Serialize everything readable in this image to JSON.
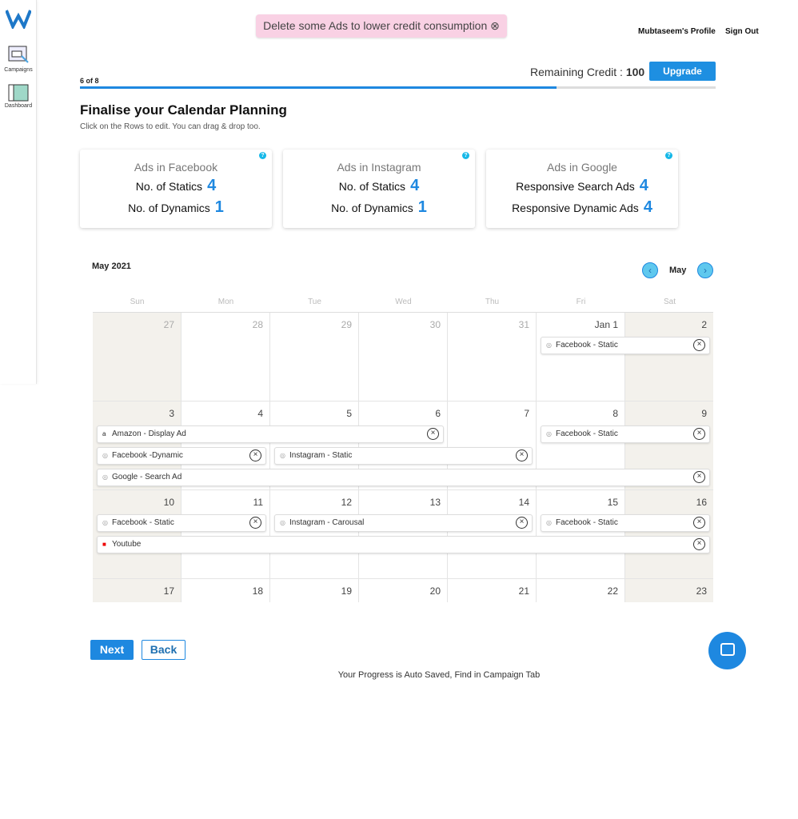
{
  "sidebar": {
    "items": [
      {
        "label": "Campaigns",
        "icon": "campaigns-icon"
      },
      {
        "label": "Dashboard",
        "icon": "dashboard-icon"
      }
    ]
  },
  "banner": {
    "text": "Delete some Ads to lower credit consumption ⊗"
  },
  "header": {
    "profile": "Mubtaseem's Profile",
    "signout": "Sign Out",
    "credit_label": "Remaining Credit : ",
    "credit_value": "100",
    "upgrade": "Upgrade"
  },
  "progress": {
    "label": "6 of 8",
    "fraction": 0.75
  },
  "page": {
    "title": "Finalise your Calendar Planning",
    "subtitle": "Click on the Rows to edit. You can drag & drop too."
  },
  "cards": [
    {
      "title": "Ads in Facebook",
      "rows": [
        {
          "label": "No. of Statics",
          "value": "4"
        },
        {
          "label": "No. of Dynamics",
          "value": "1"
        }
      ]
    },
    {
      "title": "Ads in Instagram",
      "rows": [
        {
          "label": "No. of Statics",
          "value": "4"
        },
        {
          "label": "No. of Dynamics",
          "value": "1"
        }
      ]
    },
    {
      "title": "Ads in Google",
      "rows": [
        {
          "label": "Responsive Search Ads",
          "value": "4"
        },
        {
          "label": "Responsive Dynamic Ads",
          "value": "4"
        }
      ]
    }
  ],
  "calendar": {
    "title": "May 2021",
    "month": "May",
    "days": [
      "Sun",
      "Mon",
      "Tue",
      "Wed",
      "Thu",
      "Fri",
      "Sat"
    ],
    "weeks": [
      [
        "27",
        "28",
        "29",
        "30",
        "31",
        "Jan 1",
        "2"
      ],
      [
        "3",
        "4",
        "5",
        "6",
        "7",
        "8",
        "9"
      ],
      [
        "10",
        "11",
        "12",
        "13",
        "14",
        "15",
        "16"
      ],
      [
        "17",
        "18",
        "19",
        "20",
        "21",
        "22",
        "23"
      ]
    ],
    "events": [
      {
        "label": "Facebook - Static",
        "icon": "facebook-icon",
        "week": 0,
        "start": 5,
        "span": 2,
        "lane": 0
      },
      {
        "label": "Amazon - Display Ad",
        "icon": "amazon-icon",
        "week": 1,
        "start": 0,
        "span": 4,
        "lane": 0
      },
      {
        "label": "Facebook - Static",
        "icon": "facebook-icon",
        "week": 1,
        "start": 5,
        "span": 2,
        "lane": 0
      },
      {
        "label": "Facebook -Dynamic",
        "icon": "facebook-icon",
        "week": 1,
        "start": 0,
        "span": 2,
        "lane": 1
      },
      {
        "label": "Instagram - Static",
        "icon": "instagram-icon",
        "week": 1,
        "start": 2,
        "span": 3,
        "lane": 1
      },
      {
        "label": "Google - Search Ad",
        "icon": "google-icon",
        "week": 1,
        "start": 0,
        "span": 7,
        "lane": 2
      },
      {
        "label": "Facebook - Static",
        "icon": "facebook-icon",
        "week": 2,
        "start": 0,
        "span": 2,
        "lane": 0
      },
      {
        "label": "Instagram - Carousal",
        "icon": "instagram-icon",
        "week": 2,
        "start": 2,
        "span": 3,
        "lane": 0
      },
      {
        "label": "Facebook - Static",
        "icon": "facebook-icon",
        "week": 2,
        "start": 5,
        "span": 2,
        "lane": 0
      },
      {
        "label": "Youtube",
        "icon": "youtube-icon",
        "week": 2,
        "start": 0,
        "span": 7,
        "lane": 1
      }
    ]
  },
  "footer": {
    "next": "Next",
    "back": "Back",
    "saved": "Your Progress is Auto Saved, Find in Campaign Tab"
  }
}
